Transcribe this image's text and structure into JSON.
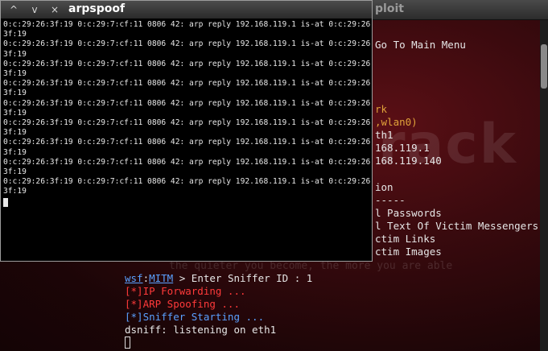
{
  "background_window": {
    "title": "ploit",
    "watermark": "rack",
    "tagline": "the quieter you become, the more you are able",
    "menu_lines": [
      {
        "text": "Go To Main Menu",
        "color": "white"
      },
      {
        "text": "rk",
        "color": "orange"
      },
      {
        "text": ",wlan0)",
        "color": "orange"
      },
      {
        "text": "th1",
        "color": "white"
      },
      {
        "text": "168.119.1",
        "color": "white"
      },
      {
        "text": "168.119.140",
        "color": "white"
      },
      {
        "text": "ion",
        "color": "white"
      },
      {
        "text": "-----",
        "color": "white"
      },
      {
        "text": "l Passwords",
        "color": "white"
      },
      {
        "text": "l Text Of Victim Messengers",
        "color": "white"
      },
      {
        "text": "ctim Links",
        "color": "white"
      },
      {
        "text": "ctim Images",
        "color": "white"
      }
    ],
    "prompt": {
      "module": "wsf",
      "submodule": "MITM",
      "text": " > Enter Sniffer ID : 1"
    },
    "status_lines": [
      {
        "text": "[*]IP Forwarding ...",
        "color": "red"
      },
      {
        "text": "[*]ARP Spoofing ...",
        "color": "red"
      },
      {
        "text": "[*]Sniffer Starting ...",
        "color": "blue"
      },
      {
        "text": "dsniff: listening on eth1",
        "color": "white"
      }
    ]
  },
  "front_window": {
    "title": "arpspoof",
    "buttons": {
      "up": "^",
      "down": "v",
      "close": "×"
    },
    "output_lines": [
      "0:c:29:26:3f:19 0:c:29:7:cf:11 0806 42: arp reply 192.168.119.1 is-at 0:c:29:26:",
      "3f:19",
      "0:c:29:26:3f:19 0:c:29:7:cf:11 0806 42: arp reply 192.168.119.1 is-at 0:c:29:26:",
      "3f:19",
      "0:c:29:26:3f:19 0:c:29:7:cf:11 0806 42: arp reply 192.168.119.1 is-at 0:c:29:26:",
      "3f:19",
      "0:c:29:26:3f:19 0:c:29:7:cf:11 0806 42: arp reply 192.168.119.1 is-at 0:c:29:26:",
      "3f:19",
      "0:c:29:26:3f:19 0:c:29:7:cf:11 0806 42: arp reply 192.168.119.1 is-at 0:c:29:26:",
      "3f:19",
      "0:c:29:26:3f:19 0:c:29:7:cf:11 0806 42: arp reply 192.168.119.1 is-at 0:c:29:26:",
      "3f:19",
      "0:c:29:26:3f:19 0:c:29:7:cf:11 0806 42: arp reply 192.168.119.1 is-at 0:c:29:26:",
      "3f:19",
      "0:c:29:26:3f:19 0:c:29:7:cf:11 0806 42: arp reply 192.168.119.1 is-at 0:c:29:26:",
      "3f:19",
      "0:c:29:26:3f:19 0:c:29:7:cf:11 0806 42: arp reply 192.168.119.1 is-at 0:c:29:26:",
      "3f:19"
    ]
  },
  "colors": {
    "terminal_bg": "#000000",
    "bg_terminal_red": "#3a0a0e",
    "orange": "#e0a23a",
    "red": "#ff3a3a",
    "blue": "#5aa0ff"
  }
}
